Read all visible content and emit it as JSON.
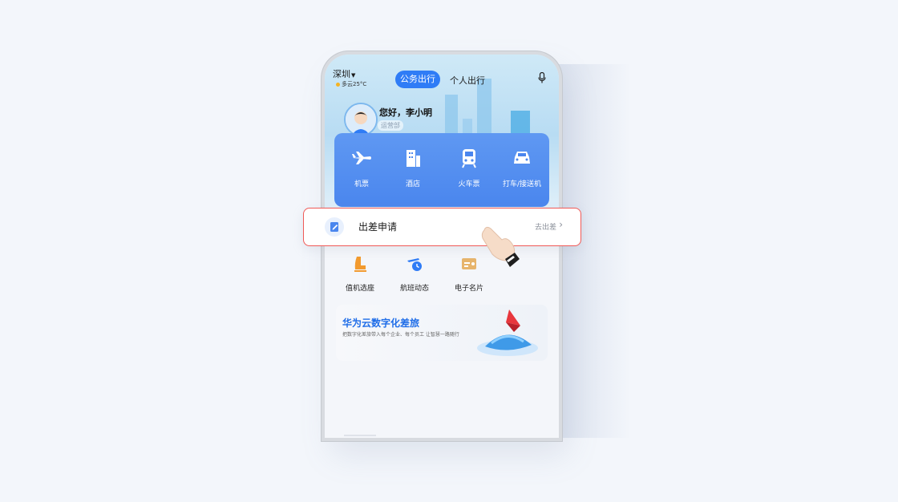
{
  "status": {
    "city": "深圳",
    "weather": "多云25°C"
  },
  "tabs": {
    "active": "公务出行",
    "other": "个人出行"
  },
  "user": {
    "greeting": "您好，李小明",
    "department": "运营部"
  },
  "services": [
    {
      "label": "机票",
      "icon": "plane-icon"
    },
    {
      "label": "酒店",
      "icon": "hotel-icon"
    },
    {
      "label": "火车票",
      "icon": "train-icon"
    },
    {
      "label": "打车/接送机",
      "icon": "car-icon"
    }
  ],
  "quick": [
    {
      "label": "值机选座",
      "icon": "seat-icon"
    },
    {
      "label": "航班动态",
      "icon": "flight-status-icon"
    },
    {
      "label": "电子名片",
      "icon": "business-card-icon"
    }
  ],
  "banner": {
    "title": "华为云数字化差旅",
    "subtitle": "把数字化差旅带入每个企业、每个员工 让智慧一路随行"
  },
  "popup": {
    "title": "出差申请",
    "link": "去出差"
  },
  "colors": {
    "accent": "#2f7cf6",
    "highlight_border": "#f05a57"
  }
}
